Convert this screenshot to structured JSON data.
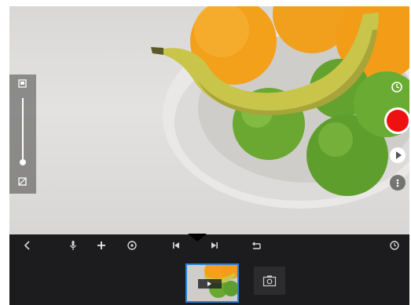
{
  "colors": {
    "record": "#ee1111",
    "toolbar_bg": "#1c1c1e",
    "selection": "#2f7fd6",
    "apple": "#6aa832",
    "orange": "#f5a51b",
    "banana": "#c7c548"
  },
  "zoom": {
    "level": 0.0,
    "top_icon": "zoom-in-icon",
    "bottom_icon": "zoom-out-icon"
  },
  "right_controls": {
    "timer_icon": "timer-icon",
    "record_icon": "record-icon",
    "play_icon": "play-icon",
    "more_icon": "more-options-icon"
  },
  "toolbar": {
    "items": [
      {
        "name": "back-icon",
        "glyph": "‹"
      },
      {
        "name": "microphone-icon",
        "glyph": "♪"
      },
      {
        "name": "add-icon",
        "glyph": "+"
      },
      {
        "name": "effects-icon",
        "glyph": "⚙"
      },
      {
        "name": "skip-back-icon",
        "glyph": "⏮"
      },
      {
        "name": "skip-forward-icon",
        "glyph": "⏭"
      },
      {
        "name": "undo-icon",
        "glyph": "↩"
      },
      {
        "name": "settings-icon",
        "glyph": "⚙"
      }
    ]
  },
  "filmstrip": {
    "thumbnail_icon": "video-thumbnail",
    "add_icon": "add-photo-icon",
    "selected_index": 0
  }
}
